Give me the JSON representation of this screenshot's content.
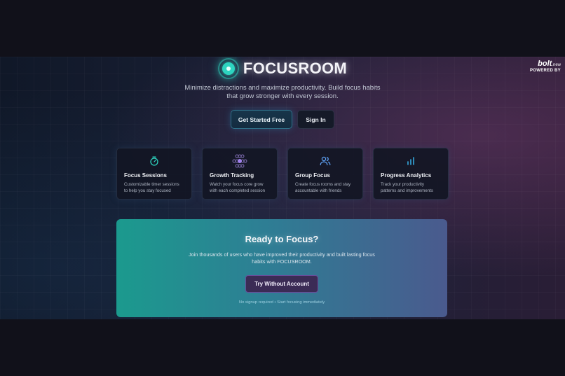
{
  "brand": {
    "name": "FOCUSROOM",
    "accent": "#2dd4bf"
  },
  "badge": {
    "logo_text": "bolt",
    "logo_suffix": ".new",
    "powered_by": "POWERED BY"
  },
  "tagline": {
    "line1": "Minimize distractions and maximize productivity. Build focus habits",
    "line2": "that grow stronger with every session."
  },
  "cta": {
    "primary_label": "Get Started Free",
    "secondary_label": "Sign In"
  },
  "features": [
    {
      "icon": "timer-icon",
      "title": "Focus Sessions",
      "desc1": "Customizable timer sessions",
      "desc2": "to help you stay focused"
    },
    {
      "icon": "growth-dots-icon",
      "title": "Growth Tracking",
      "desc1": "Watch your focus core grow",
      "desc2": "with each completed session"
    },
    {
      "icon": "users-icon",
      "title": "Group Focus",
      "desc1": "Create focus rooms and stay",
      "desc2": "accountable with friends"
    },
    {
      "icon": "bar-chart-icon",
      "title": "Progress Analytics",
      "desc1": "Track your productivity",
      "desc2": "patterns and improvements"
    }
  ],
  "banner": {
    "title": "Ready to Focus?",
    "desc1": "Join thousands of users who have improved their productivity and built lasting focus",
    "desc2": "habits with FOCUSROOM.",
    "button_label": "Try Without Account",
    "note": "No signup required • Start focusing immediately"
  },
  "colors": {
    "background": "#11111a",
    "card": "#121624",
    "banner_start": "#1b9a8e",
    "banner_end": "#4a5a8e",
    "try_button": "#3b2b55"
  }
}
